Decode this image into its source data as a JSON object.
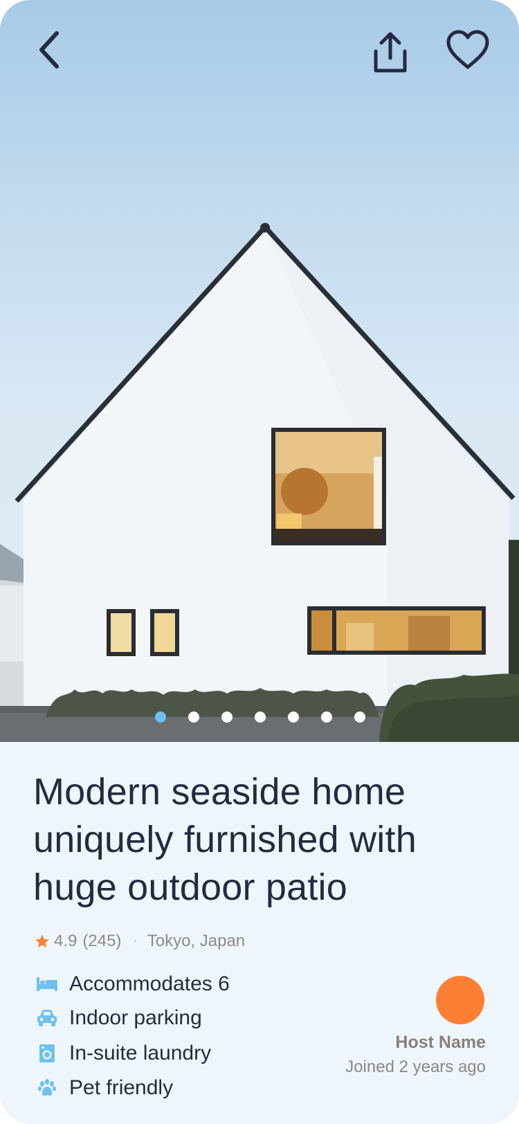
{
  "listing": {
    "title": "Modern seaside home uniquely furnished with huge outdoor patio",
    "rating": "4.9",
    "reviews": "(245)",
    "separator": "·",
    "location": "Tokyo, Japan"
  },
  "gallery": {
    "image_count": 7,
    "active_index": 0
  },
  "amenities": [
    {
      "icon": "bed-icon",
      "label": "Accommodates 6"
    },
    {
      "icon": "car-icon",
      "label": "Indoor parking"
    },
    {
      "icon": "washer-icon",
      "label": "In-suite laundry"
    },
    {
      "icon": "paw-icon",
      "label": "Pet friendly"
    }
  ],
  "host": {
    "name": "Host Name",
    "joined": "Joined 2 years ago"
  },
  "colors": {
    "accent": "#6fc0ee",
    "avatar": "#fd7f33",
    "star": "#fd7f33",
    "title_text": "#262a40",
    "background": "#eef6fc"
  }
}
